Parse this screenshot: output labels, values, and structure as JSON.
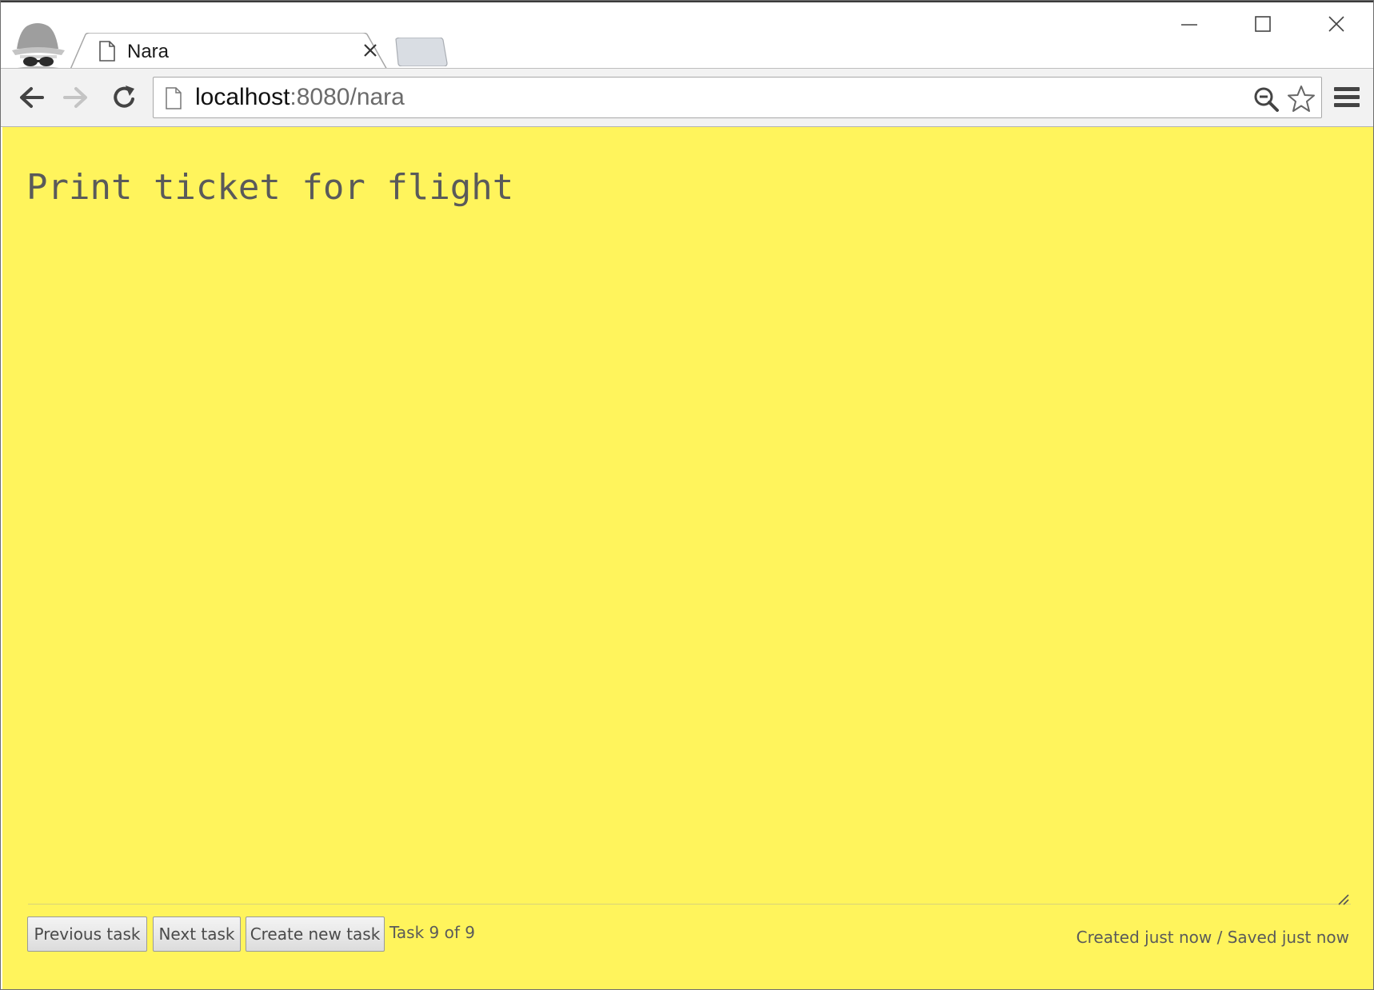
{
  "browser": {
    "tab": {
      "title": "Nara",
      "icon": "page-icon"
    },
    "url": {
      "host": "localhost",
      "rest": ":8080/nara"
    },
    "icons": {
      "incognito": "incognito-icon",
      "back": "back-arrow-icon",
      "forward": "forward-arrow-icon",
      "reload": "reload-icon",
      "zoom": "zoom-icon",
      "bookmark": "star-icon",
      "menu": "hamburger-menu-icon",
      "minimize": "minimize-icon",
      "maximize": "maximize-icon",
      "close": "close-icon"
    }
  },
  "page": {
    "background": "#fff45c",
    "task_text": "Print ticket for flight",
    "buttons": {
      "previous": "Previous task",
      "next": "Next task",
      "create": "Create new task"
    },
    "counter": "Task 9 of 9",
    "status": "Created just now / Saved just now"
  }
}
